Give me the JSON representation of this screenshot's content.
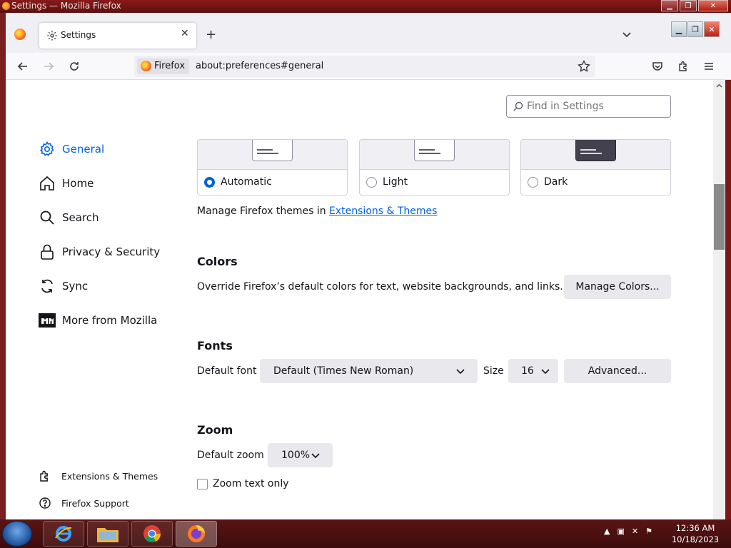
{
  "window": {
    "title": "Settings — Mozilla Firefox",
    "controls": [
      "minimize",
      "restore",
      "close"
    ]
  },
  "tabs": [
    {
      "label": "Settings",
      "icon": "gear-icon",
      "active": true
    }
  ],
  "navbar": {
    "identity_label": "Firefox",
    "url": "about:preferences#general"
  },
  "search": {
    "placeholder": "Find in Settings"
  },
  "sidebar": {
    "items": [
      {
        "label": "General",
        "icon": "gear-icon",
        "selected": true
      },
      {
        "label": "Home",
        "icon": "home-icon"
      },
      {
        "label": "Search",
        "icon": "search-icon"
      },
      {
        "label": "Privacy & Security",
        "icon": "lock-icon"
      },
      {
        "label": "Sync",
        "icon": "sync-icon"
      },
      {
        "label": "More from Mozilla",
        "icon": "mozilla-icon"
      }
    ],
    "footer": [
      {
        "label": "Extensions & Themes",
        "icon": "puzzle-icon"
      },
      {
        "label": "Firefox Support",
        "icon": "help-icon"
      }
    ]
  },
  "appearance": {
    "options": [
      {
        "label": "Automatic",
        "checked": true
      },
      {
        "label": "Light",
        "checked": false
      },
      {
        "label": "Dark",
        "checked": false
      }
    ],
    "manage_text": "Manage Firefox themes in",
    "manage_link": "Extensions & Themes"
  },
  "colors": {
    "heading": "Colors",
    "description": "Override Firefox’s default colors for text, website backgrounds, and links.",
    "button": "Manage Colors..."
  },
  "fonts": {
    "heading": "Fonts",
    "default_font_label": "Default font",
    "default_font_value": "Default (Times New Roman)",
    "size_label": "Size",
    "size_value": "16",
    "advanced_button": "Advanced..."
  },
  "zoom": {
    "heading": "Zoom",
    "default_zoom_label": "Default zoom",
    "default_zoom_value": "100%",
    "text_only_label": "Zoom text only",
    "text_only_checked": false
  },
  "taskbar": {
    "apps": [
      "internet-explorer-icon",
      "file-explorer-icon",
      "chrome-icon",
      "firefox-icon"
    ],
    "active_app": "firefox-icon",
    "time": "12:36 AM",
    "date": "10/18/2023"
  },
  "colors_theme": {
    "accent": "#0061e0",
    "text": "#15141a",
    "button_bg": "#e9e9ed"
  }
}
